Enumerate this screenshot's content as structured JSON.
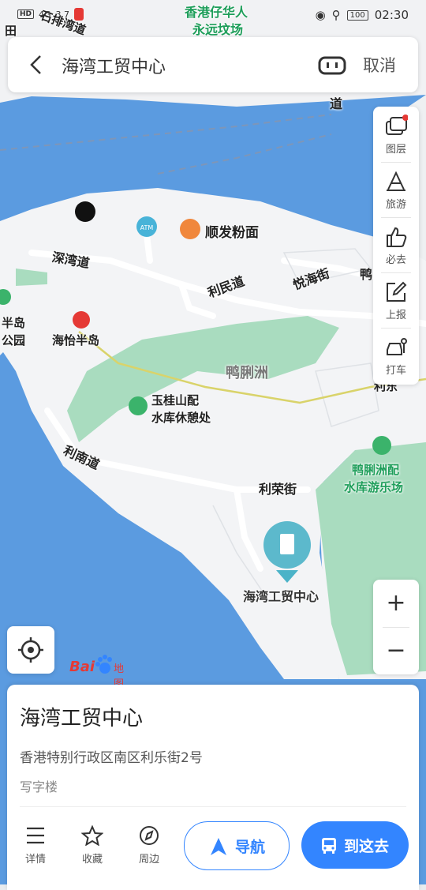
{
  "status_bar": {
    "left_signal": "4G",
    "left_speed": "3.7",
    "hd": "HD",
    "time": "02:30",
    "battery": "100"
  },
  "search": {
    "title": "海湾工贸中心",
    "cancel_label": "取消"
  },
  "tools": [
    {
      "label": "图层",
      "icon": "layers-icon"
    },
    {
      "label": "旅游",
      "icon": "travel-icon"
    },
    {
      "label": "必去",
      "icon": "thumbs-up-icon"
    },
    {
      "label": "上报",
      "icon": "edit-report-icon"
    },
    {
      "label": "打车",
      "icon": "taxi-icon"
    }
  ],
  "zoom": {
    "in": "+",
    "out": "−"
  },
  "logo": {
    "bai": "Bai",
    "ditu": "地图"
  },
  "map_labels": {
    "top_place": "香港仔华人",
    "top_place2": "永远坟场",
    "shek_pai_wan": "石排湾道",
    "tin": "田",
    "dao": "道",
    "shun_fat": "顺发粉面",
    "sham_wan_rd": "深湾道",
    "lee_man_rd": "利民道",
    "yuet_hoi_st": "悦海街",
    "duck_right": "鸭",
    "peninsula1": "半岛",
    "peninsula2": "公园",
    "mtr": "海怡半岛",
    "ap_lei_chau": "鸭脷洲",
    "lee_right": "利东",
    "yuk_kwai1": "玉桂山配",
    "yuk_kwai2": "水库休憩处",
    "lee_nam_rd": "利南道",
    "lee_wing_st": "利荣街",
    "ap_lei_park1": "鸭脷洲配",
    "ap_lei_park2": "水库游乐场",
    "poi": "海湾工贸中心",
    "atm": "ATM"
  },
  "card": {
    "title": "海湾工贸中心",
    "address": "香港特别行政区南区利乐街2号",
    "category": "写字楼"
  },
  "actions": [
    {
      "label": "详情",
      "icon": "list-icon"
    },
    {
      "label": "收藏",
      "icon": "star-icon"
    },
    {
      "label": "周边",
      "icon": "compass-icon"
    }
  ],
  "navigate_label": "导航",
  "go_here_label": "到这去",
  "colors": {
    "water": "#5b9be0",
    "land": "#f2f3f5",
    "park": "#a9dcbf",
    "accent": "#3385ff"
  }
}
